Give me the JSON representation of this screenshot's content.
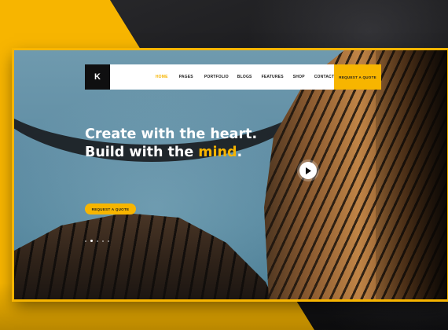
{
  "brand": {
    "logo_letter": "K"
  },
  "nav": {
    "items": [
      {
        "label": "HOME",
        "active": true
      },
      {
        "label": "PAGES",
        "active": false
      },
      {
        "label": "PORTFOLIO",
        "active": false
      },
      {
        "label": "BLOGS",
        "active": false
      },
      {
        "label": "FEATURES",
        "active": false
      },
      {
        "label": "SHOP",
        "active": false
      },
      {
        "label": "CONTACT",
        "active": false
      }
    ],
    "cta_label": "REQUEST A QUOTE"
  },
  "hero": {
    "headline_part1": "Create with the heart. Build with the ",
    "headline_accent": "mind",
    "headline_end": ".",
    "cta_label": "REQUEST A QUOTE",
    "play_icon": "play-icon",
    "slides": {
      "count": 5,
      "active_index": 1
    }
  },
  "colors": {
    "accent": "#f7b500",
    "dark": "#0f0f10",
    "text_light": "#ffffff"
  }
}
